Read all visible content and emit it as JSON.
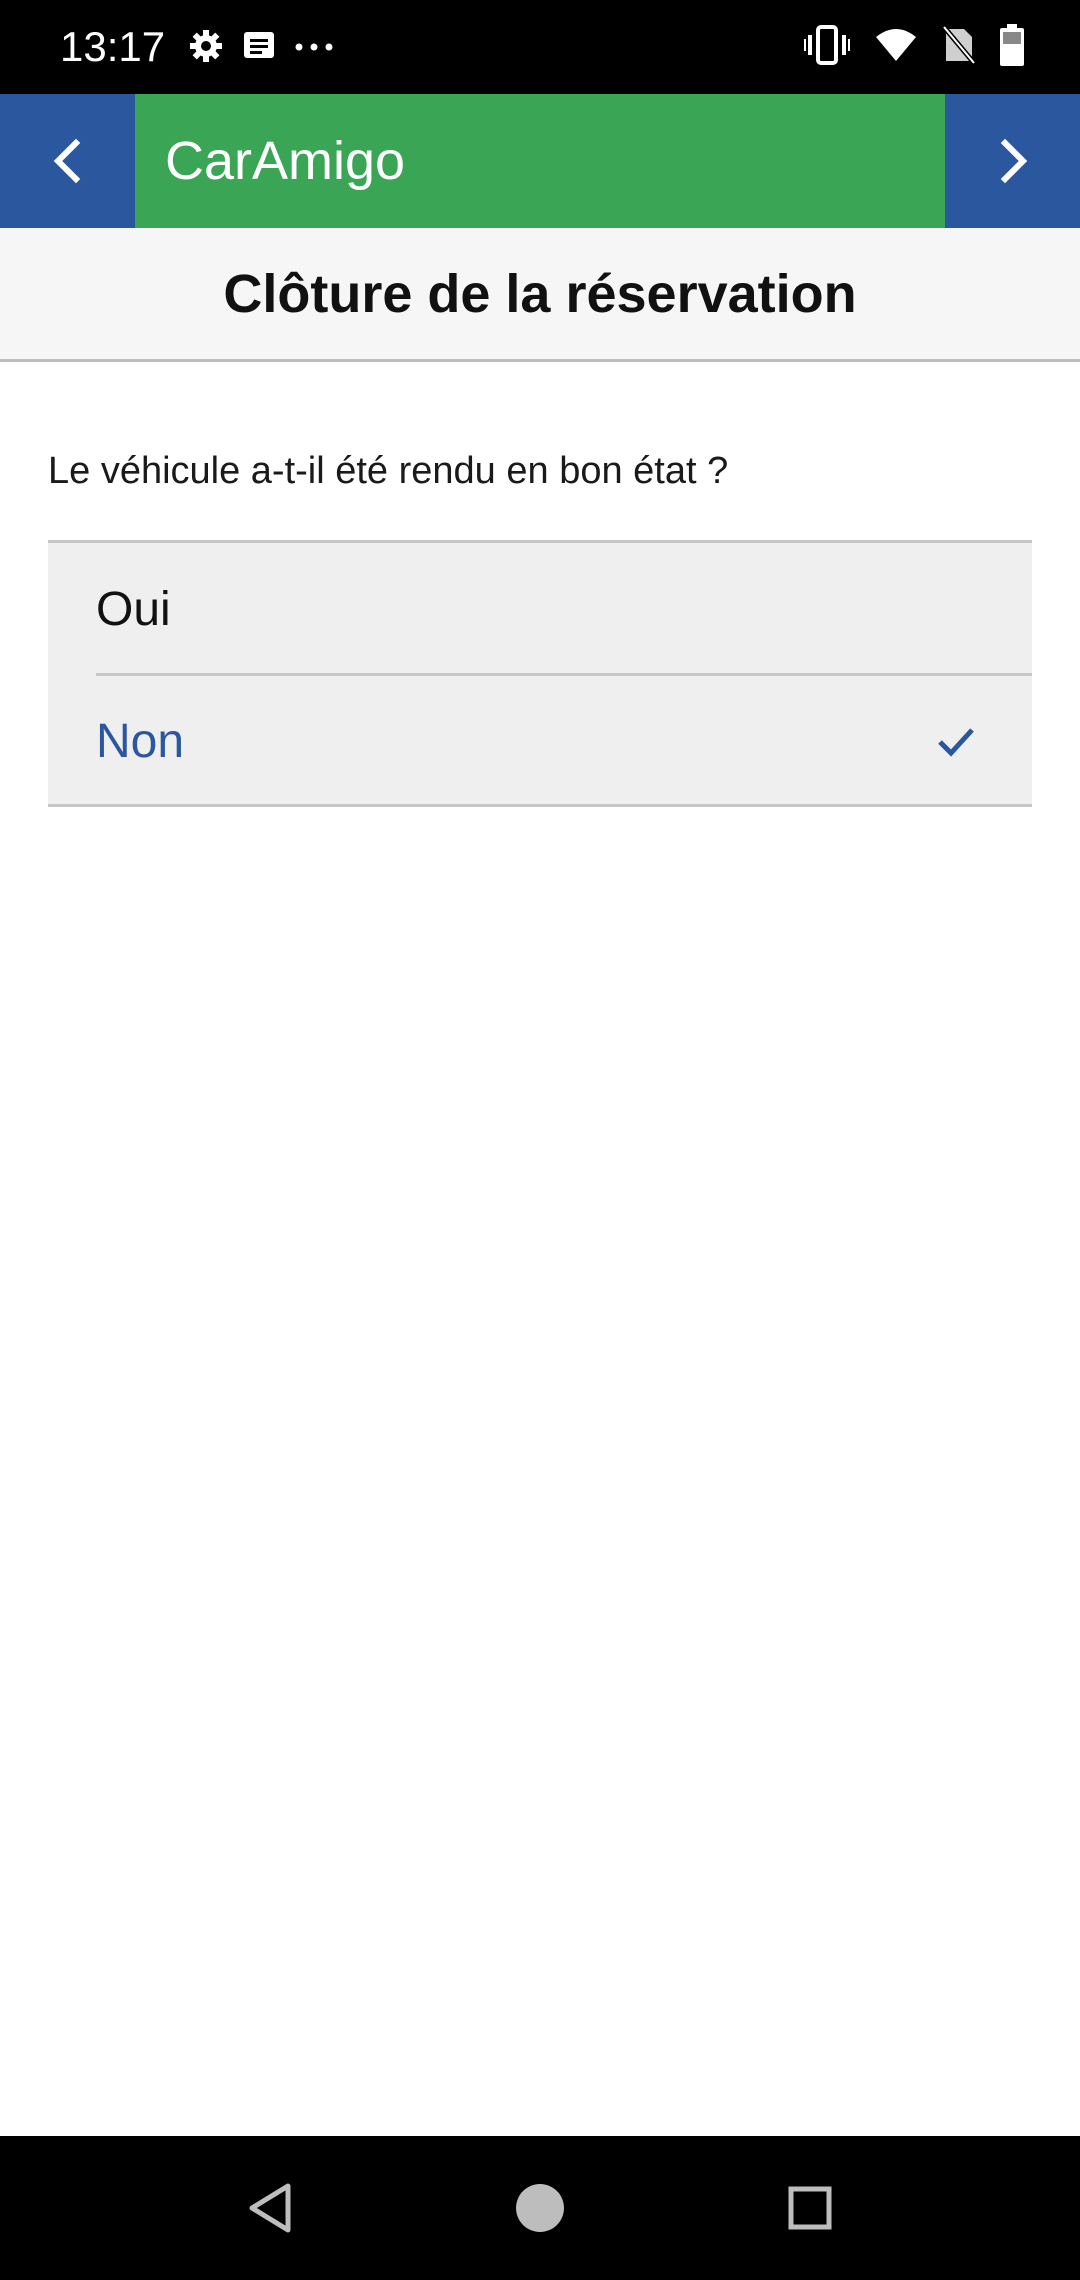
{
  "status_bar": {
    "time": "13:17",
    "left_icons": [
      "settings-gear-icon",
      "message-icon",
      "more-dots-icon"
    ],
    "right_icons": [
      "vibrate-icon",
      "wifi-icon",
      "no-sim-icon",
      "battery-icon"
    ]
  },
  "app_bar": {
    "title": "CarAmigo",
    "back_icon": "chevron-left-icon",
    "forward_icon": "chevron-right-icon"
  },
  "page": {
    "title": "Clôture de la réservation"
  },
  "form": {
    "question": "Le véhicule a-t-il été rendu en bon état ?",
    "options": [
      {
        "label": "Oui",
        "selected": false
      },
      {
        "label": "Non",
        "selected": true
      }
    ]
  },
  "nav_bar": {
    "icons": [
      "triangle-back-icon",
      "circle-home-icon",
      "square-recents-icon"
    ]
  },
  "colors": {
    "status_bar": "#000000",
    "app_bar_green": "#3aa655",
    "nav_blue": "#2b579f",
    "header_bg": "#f6f6f6",
    "option_bg": "#efefef",
    "selected_text": "#2b579f"
  }
}
